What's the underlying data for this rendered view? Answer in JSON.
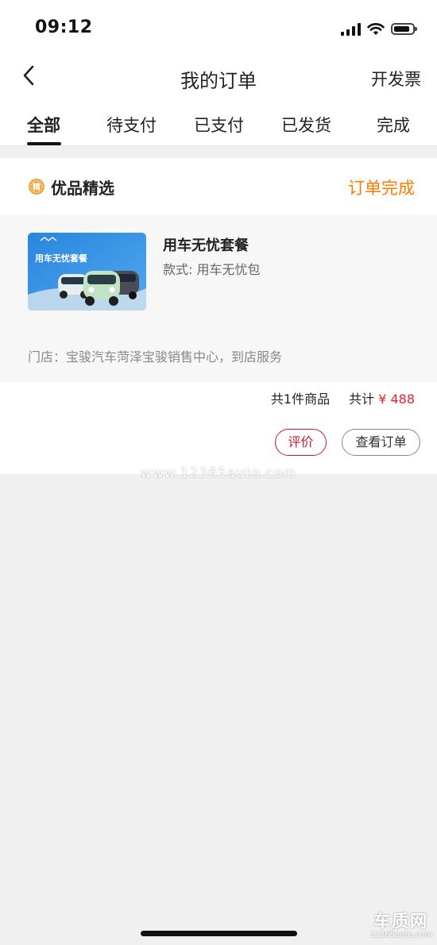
{
  "status_bar": {
    "time": "09:12"
  },
  "nav": {
    "title": "我的订单",
    "action": "开发票"
  },
  "tabs": [
    {
      "label": "全部",
      "active": true
    },
    {
      "label": "待支付",
      "active": false
    },
    {
      "label": "已支付",
      "active": false
    },
    {
      "label": "已发货",
      "active": false
    },
    {
      "label": "完成",
      "active": false
    }
  ],
  "order": {
    "shop_badge": "精",
    "shop_name": "优品精选",
    "status": "订单完成",
    "item": {
      "thumb_text": "用车无忧套餐",
      "name": "用车无忧套餐",
      "spec": "款式: 用车无忧包"
    },
    "store_text": "门店：宝骏汽车菏泽宝骏销售中心，到店服务",
    "count_text": "共1件商品",
    "total_label": "共计",
    "total_price": "¥ 488",
    "buttons": {
      "review": "评价",
      "view": "查看订单"
    }
  },
  "watermarks": {
    "center": "www.12365auto.com",
    "logo": "车质网",
    "logo_url": "12365auto.com"
  },
  "colors": {
    "status_orange": "#ff7a00",
    "price_red": "#e2252f",
    "review_red": "#c8192c",
    "background": "#f0f0f0"
  }
}
